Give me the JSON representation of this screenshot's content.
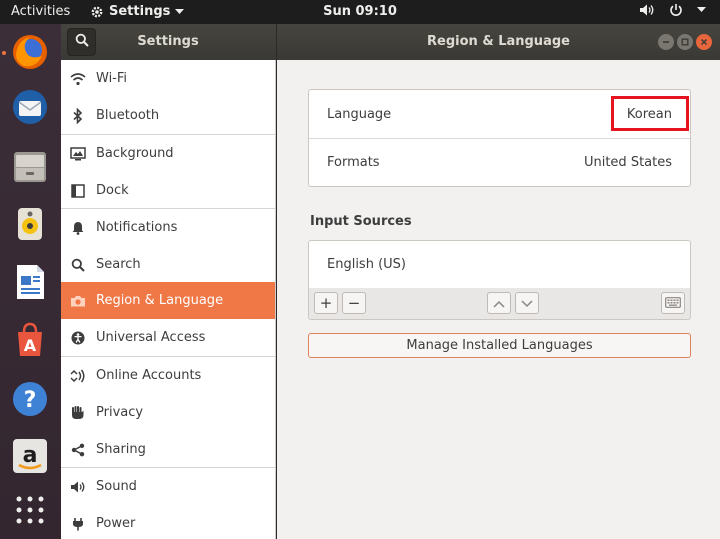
{
  "topbar": {
    "activities": "Activities",
    "app_name": "Settings",
    "clock": "Sun 09:10"
  },
  "window": {
    "sidebar_title": "Settings",
    "panel_title": "Region & Language"
  },
  "sidebar": {
    "items": [
      {
        "label": "Wi-Fi",
        "icon": "wifi-icon"
      },
      {
        "label": "Bluetooth",
        "icon": "bluetooth-icon"
      },
      {
        "label": "Background",
        "icon": "background-icon"
      },
      {
        "label": "Dock",
        "icon": "dock-icon"
      },
      {
        "label": "Notifications",
        "icon": "bell-icon"
      },
      {
        "label": "Search",
        "icon": "search-icon"
      },
      {
        "label": "Region & Language",
        "icon": "camera-icon",
        "active": true
      },
      {
        "label": "Universal Access",
        "icon": "accessibility-icon"
      },
      {
        "label": "Online Accounts",
        "icon": "online-accounts-icon"
      },
      {
        "label": "Privacy",
        "icon": "hand-icon"
      },
      {
        "label": "Sharing",
        "icon": "share-icon"
      },
      {
        "label": "Sound",
        "icon": "speaker-icon"
      },
      {
        "label": "Power",
        "icon": "plug-icon"
      }
    ]
  },
  "region": {
    "language_label": "Language",
    "language_value": "Korean",
    "formats_label": "Formats",
    "formats_value": "United States",
    "input_sources_title": "Input Sources",
    "input_source": "English (US)",
    "add_label": "+",
    "remove_label": "−",
    "manage_button": "Manage Installed Languages"
  },
  "colors": {
    "accent": "#f07746",
    "highlight": "#e5141e",
    "dock": "#3a2b36"
  }
}
